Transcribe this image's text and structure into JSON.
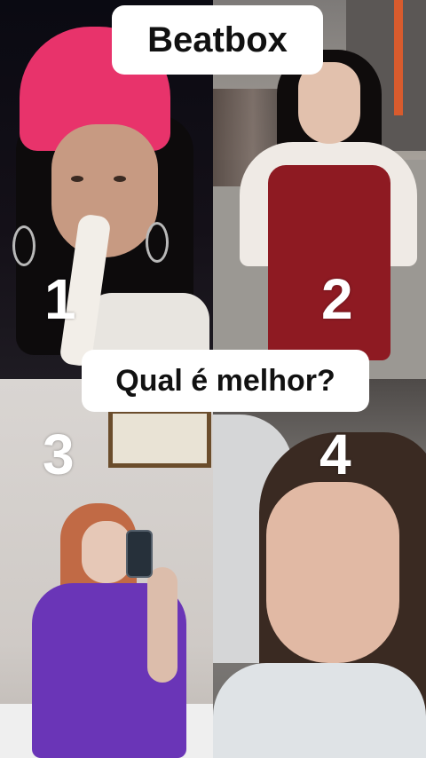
{
  "video": {
    "title": "Beatbox",
    "question": "Qual é melhor?",
    "panels": [
      {
        "number": "1"
      },
      {
        "number": "2"
      },
      {
        "number": "3"
      },
      {
        "number": "4"
      }
    ]
  }
}
